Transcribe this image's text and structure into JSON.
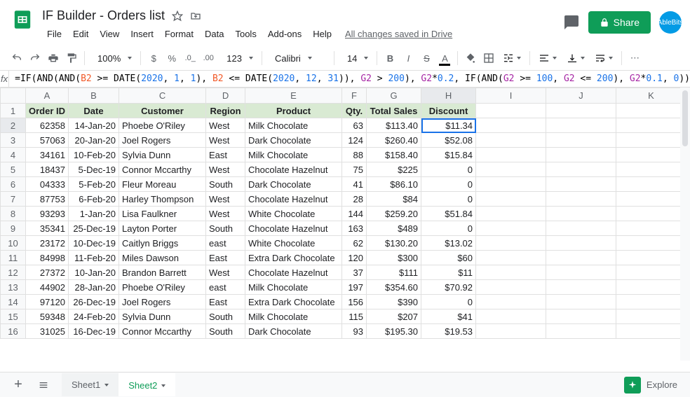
{
  "document_title": "IF Builder - Orders list",
  "menus": [
    "File",
    "Edit",
    "View",
    "Insert",
    "Format",
    "Data",
    "Tools",
    "Add-ons",
    "Help"
  ],
  "saved_text": "All changes saved in Drive",
  "share_label": "Share",
  "avatar_text": "AbleBits",
  "toolbar": {
    "zoom": "100%",
    "font": "Calibri",
    "font_size": "14",
    "more_formats": "123"
  },
  "formula": {
    "parts": [
      {
        "t": "=",
        "c": "black"
      },
      {
        "t": "IF",
        "c": "black"
      },
      {
        "t": "(",
        "c": "black"
      },
      {
        "t": "AND",
        "c": "black"
      },
      {
        "t": "(",
        "c": "black"
      },
      {
        "t": "AND",
        "c": "black"
      },
      {
        "t": "(",
        "c": "black"
      },
      {
        "t": "B2",
        "c": "orange"
      },
      {
        "t": " >= ",
        "c": "black"
      },
      {
        "t": "DATE",
        "c": "black"
      },
      {
        "t": "(",
        "c": "black"
      },
      {
        "t": "2020",
        "c": "blue"
      },
      {
        "t": ", ",
        "c": "black"
      },
      {
        "t": "1",
        "c": "blue"
      },
      {
        "t": ", ",
        "c": "black"
      },
      {
        "t": "1",
        "c": "blue"
      },
      {
        "t": "), ",
        "c": "black"
      },
      {
        "t": "B2",
        "c": "orange"
      },
      {
        "t": " <= ",
        "c": "black"
      },
      {
        "t": "DATE",
        "c": "black"
      },
      {
        "t": "(",
        "c": "black"
      },
      {
        "t": "2020",
        "c": "blue"
      },
      {
        "t": ", ",
        "c": "black"
      },
      {
        "t": "12",
        "c": "blue"
      },
      {
        "t": ", ",
        "c": "black"
      },
      {
        "t": "31",
        "c": "blue"
      },
      {
        "t": ")), ",
        "c": "black"
      },
      {
        "t": "G2",
        "c": "purple"
      },
      {
        "t": " > ",
        "c": "black"
      },
      {
        "t": "200",
        "c": "blue"
      },
      {
        "t": "), ",
        "c": "black"
      },
      {
        "t": "G2",
        "c": "purple"
      },
      {
        "t": "*",
        "c": "black"
      },
      {
        "t": "0.2",
        "c": "blue"
      },
      {
        "t": ", ",
        "c": "black"
      },
      {
        "t": "IF",
        "c": "black"
      },
      {
        "t": "(",
        "c": "black"
      },
      {
        "t": "AND",
        "c": "black"
      },
      {
        "t": "(",
        "c": "black"
      },
      {
        "t": "G2",
        "c": "purple"
      },
      {
        "t": " >= ",
        "c": "black"
      },
      {
        "t": "100",
        "c": "blue"
      },
      {
        "t": ", ",
        "c": "black"
      },
      {
        "t": "G2",
        "c": "purple"
      },
      {
        "t": " <= ",
        "c": "black"
      },
      {
        "t": "200",
        "c": "blue"
      },
      {
        "t": "), ",
        "c": "black"
      },
      {
        "t": "G2",
        "c": "purple"
      },
      {
        "t": "*",
        "c": "black"
      },
      {
        "t": "0.1",
        "c": "blue"
      },
      {
        "t": ", ",
        "c": "black"
      },
      {
        "t": "0",
        "c": "blue"
      },
      {
        "t": "))",
        "c": "black"
      }
    ]
  },
  "columns": [
    "A",
    "B",
    "C",
    "D",
    "E",
    "F",
    "G",
    "H",
    "I",
    "J",
    "K"
  ],
  "headers": [
    "Order ID",
    "Date",
    "Customer",
    "Region",
    "Product",
    "Qty.",
    "Total Sales",
    "Discount"
  ],
  "rows": [
    {
      "n": 2,
      "c": [
        "62358",
        "14-Jan-20",
        "Phoebe O'Riley",
        "West",
        "Milk Chocolate",
        "63",
        "$113.40",
        "$11.34"
      ]
    },
    {
      "n": 3,
      "c": [
        "57063",
        "20-Jan-20",
        "Joel Rogers",
        "West",
        "Dark Chocolate",
        "124",
        "$260.40",
        "$52.08"
      ]
    },
    {
      "n": 4,
      "c": [
        "34161",
        "10-Feb-20",
        "Sylvia Dunn",
        "East",
        "Milk Chocolate",
        "88",
        "$158.40",
        "$15.84"
      ]
    },
    {
      "n": 5,
      "c": [
        "18437",
        "5-Dec-19",
        "Connor Mccarthy",
        "West",
        "Chocolate Hazelnut",
        "75",
        "$225",
        "0"
      ]
    },
    {
      "n": 6,
      "c": [
        "04333",
        "5-Feb-20",
        "Fleur Moreau",
        "South",
        "Dark Chocolate",
        "41",
        "$86.10",
        "0"
      ]
    },
    {
      "n": 7,
      "c": [
        "87753",
        "6-Feb-20",
        "Harley Thompson",
        "West",
        "Chocolate Hazelnut",
        "28",
        "$84",
        "0"
      ]
    },
    {
      "n": 8,
      "c": [
        "93293",
        "1-Jan-20",
        "Lisa Faulkner",
        "West",
        "White Chocolate",
        "144",
        "$259.20",
        "$51.84"
      ]
    },
    {
      "n": 9,
      "c": [
        "35341",
        "25-Dec-19",
        "Layton Porter",
        "South",
        "Chocolate Hazelnut",
        "163",
        "$489",
        "0"
      ]
    },
    {
      "n": 10,
      "c": [
        "23172",
        "10-Dec-19",
        "Caitlyn Briggs",
        "east",
        "White Chocolate",
        "62",
        "$130.20",
        "$13.02"
      ]
    },
    {
      "n": 11,
      "c": [
        "84998",
        "11-Feb-20",
        "Miles Dawson",
        "East",
        "Extra Dark Chocolate",
        "120",
        "$300",
        "$60"
      ]
    },
    {
      "n": 12,
      "c": [
        "27372",
        "10-Jan-20",
        "Brandon Barrett",
        "West",
        "Chocolate Hazelnut",
        "37",
        "$111",
        "$11"
      ]
    },
    {
      "n": 13,
      "c": [
        "44902",
        "28-Jan-20",
        "Phoebe O'Riley",
        "east",
        "Milk Chocolate",
        "197",
        "$354.60",
        "$70.92"
      ]
    },
    {
      "n": 14,
      "c": [
        "97120",
        "26-Dec-19",
        "Joel Rogers",
        "East",
        "Extra Dark Chocolate",
        "156",
        "$390",
        "0"
      ]
    },
    {
      "n": 15,
      "c": [
        "59348",
        "24-Feb-20",
        "Sylvia Dunn",
        "South",
        "Milk Chocolate",
        "115",
        "$207",
        "$41"
      ]
    },
    {
      "n": 16,
      "c": [
        "31025",
        "16-Dec-19",
        "Connor Mccarthy",
        "South",
        "Dark Chocolate",
        "93",
        "$195.30",
        "$19.53"
      ]
    }
  ],
  "sheets": [
    {
      "name": "Sheet1",
      "active": false
    },
    {
      "name": "Sheet2",
      "active": true
    }
  ],
  "explore_label": "Explore",
  "selected_cell": {
    "row": 2,
    "col": "H"
  }
}
